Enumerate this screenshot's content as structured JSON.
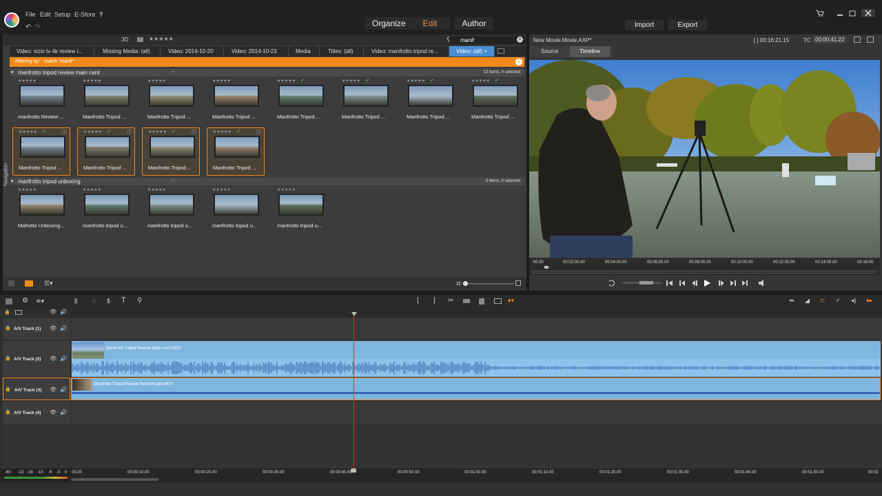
{
  "menu": {
    "file": "File",
    "edit": "Edit",
    "setup": "Setup",
    "estore": "E-Store",
    "help": "?"
  },
  "modes": {
    "organize": "Organize",
    "edit": "Edit",
    "author": "Author"
  },
  "actions": {
    "import": "Import",
    "export": "Export"
  },
  "library": {
    "label_3d": "3D",
    "rating_filter": "★★★★★",
    "search": "manfr",
    "tabs": [
      "Video: vizio tv 4k review i...",
      "Missing Media: (all)",
      "Video: 2014-10-20",
      "Video: 2014-10-23",
      "Media",
      "Titles: (all)",
      "Video: manfrotto tripod re...",
      "Video: (all)"
    ],
    "filter_label": "Filtering by:",
    "filter_value": "match \"manfr\"",
    "navigation": "Navigation",
    "groups": [
      {
        "name": "manfrotto tripod review main card",
        "count": "12 items, 4 selected",
        "clips": [
          "manfrotto Review ...",
          "Manfrotto Tripod ...",
          "Manfrotto Tripod ...",
          "Manfrotto Tripod ...",
          "Manfrotto Tripod ...",
          "Manfrotto Tripod ...",
          "Manfrotto Tripod ...",
          "Manfrotto Tripod ..."
        ],
        "selected": [
          "Manfrotto Tripod ...",
          "Manfrotto Tripod ...",
          "Manfrotto Tripod ...",
          "Manfrotto Tripod ..."
        ]
      },
      {
        "name": "manfrotto tripod unboxing",
        "count": "5 items, 0 selected",
        "clips": [
          "Mafrotto Unboxing...",
          "manfrotto tripod u...",
          "manfrotto tripod u...",
          "manfrotto tripod u...",
          "manfrotto tripod u..."
        ]
      }
    ],
    "stars": "★★★★★"
  },
  "preview": {
    "project": "New Movie.Movie.AXP*",
    "duration": "[ ] 00:16:21.15",
    "tc_label": "TC",
    "timecode": "00:00:41.22",
    "tabs": {
      "source": "Source",
      "timeline": "Timeline"
    },
    "ruler": [
      ":00.00",
      "00:02:00.00",
      "00:04:00.00",
      "00:06:00.00",
      "00:08:00.00",
      "00:10:00.00",
      "00:12:00.00",
      "00:14:00.00",
      "00:16:00."
    ]
  },
  "timeline": {
    "tracks": [
      {
        "name": "A/V Track (1)"
      },
      {
        "name": "A/V Track (2)",
        "clip": "Manfrotto Tripod Review Main card.MOV"
      },
      {
        "name": "A/V Track (3)",
        "clip": "Manfrotto Tripod Review Second card.MP4"
      },
      {
        "name": "A/V Track (4)"
      }
    ],
    "meter": [
      "-60",
      "-22",
      "-16",
      "-10",
      "-6",
      "-3",
      "0"
    ],
    "ruler": [
      "00.00",
      "00:00:10.00",
      "00:00:20.00",
      "00:00:30.00",
      "00:00:40.00",
      "00:00:50.00",
      "00:01:00.00",
      "00:01:10.00",
      "00:01:20.00",
      "00:01:30.00",
      "00:01:40.00",
      "00:01:50.00",
      "00:02"
    ]
  },
  "colors": {
    "accent": "#f28a1a",
    "selected_tab": "#4a8fd4",
    "clip_blue": "#7fb6e0"
  }
}
